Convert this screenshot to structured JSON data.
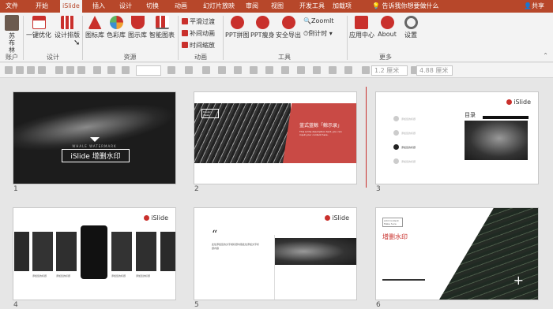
{
  "tabs": [
    "文件",
    "开始",
    "iSlide",
    "插入",
    "设计",
    "切换",
    "动画",
    "幻灯片放映",
    "审阅",
    "视图",
    "开发工具",
    "加载项"
  ],
  "tell_me": "告诉我你想要做什么",
  "share": "共享",
  "ribbon": {
    "account": {
      "name": "苏布林",
      "group": "账户"
    },
    "design": {
      "one_click": "一键优化",
      "layout": "设计排版",
      "group": "设计"
    },
    "resources": {
      "items": [
        "图标库",
        "色彩库",
        "图示库",
        "智能图表"
      ],
      "group": "资源"
    },
    "animation": {
      "items": [
        "平滑过渡",
        "补间动画",
        "时间缩放"
      ],
      "group": "动画"
    },
    "tools": {
      "items": [
        "PPT拼图",
        "PPT瘦身",
        "安全导出"
      ],
      "zoomit": "ZoomIt",
      "timer": "倒计时",
      "group": "工具"
    },
    "more": {
      "items": [
        "应用中心",
        "About",
        "设置"
      ],
      "group": "更多"
    }
  },
  "format_bar": {
    "width": "1.2 厘米",
    "height": "4.88 厘米"
  },
  "slides": [
    {
      "num": "1",
      "subtitle": "WHALE WATERMARK",
      "title": "iSlide 增删水印"
    },
    {
      "num": "2",
      "badge": "Design Week",
      "title": "蓝式蓝鲸「鲸示录」",
      "text": "This is the description text, you can input your content here."
    },
    {
      "num": "3",
      "logo": "iSlide",
      "title": "目录",
      "items": [
        "添加您的标题",
        "添加您的标题",
        "添加您的标题",
        "添加您的标题"
      ]
    },
    {
      "num": "4",
      "logo": "iSlide",
      "captions": [
        "添加您的标题",
        "添加您的标题",
        "添加您的标题",
        "添加您的标题"
      ]
    },
    {
      "num": "5",
      "logo": "iSlide",
      "quote": "“",
      "text": "此处添加您的文字或标题内容此处添加文字标题内容"
    },
    {
      "num": "6",
      "badge": "Add Content Make Sure",
      "title": "增删水印"
    }
  ]
}
